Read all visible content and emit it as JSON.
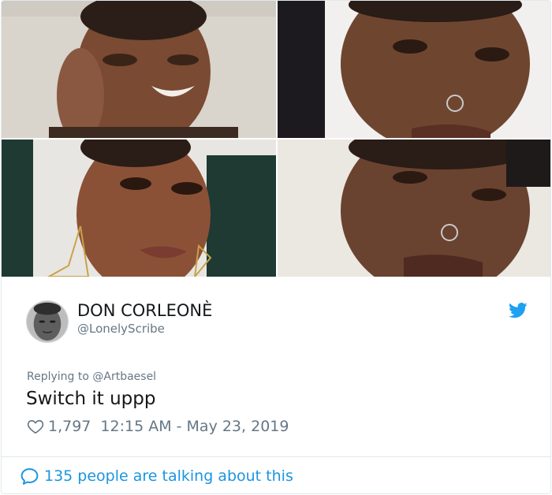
{
  "tweet": {
    "author": {
      "display_name": "DON CORLEONÈ",
      "handle": "@LonelyScribe"
    },
    "replying_to": "Replying to @Artbaesel",
    "text": "Switch it uppp",
    "likes": "1,797",
    "timestamp": "12:15 AM - May 23, 2019",
    "talking_about": "135 people are talking about this"
  },
  "icons": {
    "brand": "twitter-bird-icon",
    "like": "heart-outline-icon",
    "conversation": "speech-bubble-icon"
  },
  "colors": {
    "twitter_blue": "#1da1f2",
    "link_blue": "#1b95e0",
    "secondary_text": "#657786",
    "primary_text": "#14171a",
    "border": "#e1e8ed"
  }
}
